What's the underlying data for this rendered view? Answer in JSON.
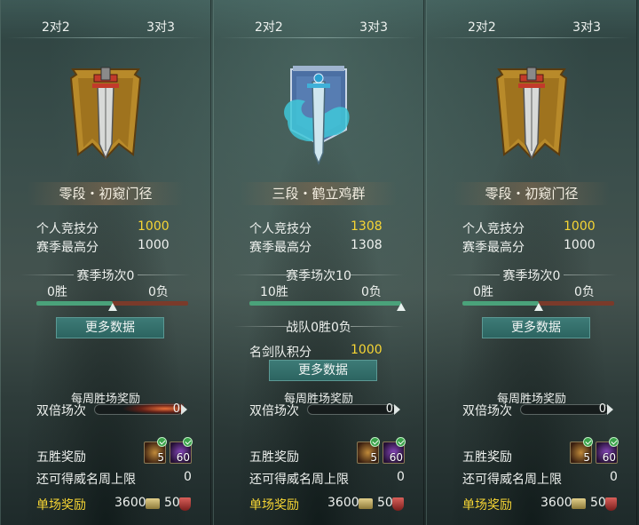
{
  "panels": [
    {
      "tabs": [
        "2对2",
        "3对3"
      ],
      "emblem": "banner-sword-bronze",
      "rank_title": "零段・初窥门径",
      "personal_score_label": "个人竞技分",
      "personal_score": "1000",
      "season_high_label": "赛季最高分",
      "season_high": "1000",
      "season_matches_title": "赛季场次0",
      "wins": "0胜",
      "losses": "0负",
      "win_ratio": 0.5,
      "more_button": "更多数据",
      "weekly_title": "每周胜场奖励",
      "double_label": "双倍场次",
      "double_value": "0",
      "five_win_label": "五胜奖励",
      "reward_items": [
        {
          "icon": "tactics-scroll-icon",
          "count": "5"
        },
        {
          "icon": "purple-gem-icon",
          "count": "60"
        }
      ],
      "remaining_label": "还可得威名周上限",
      "remaining_value": "0",
      "single_reward_label": "单场奖励",
      "coin_value": "3600",
      "shield_value": "50"
    },
    {
      "tabs": [
        "2对2",
        "3对3"
      ],
      "emblem": "banner-sword-crane",
      "rank_title": "三段・鹤立鸡群",
      "personal_score_label": "个人竞技分",
      "personal_score": "1308",
      "season_high_label": "赛季最高分",
      "season_high": "1308",
      "season_matches_title": "赛季场次10",
      "wins": "10胜",
      "losses": "0负",
      "win_ratio": 1.0,
      "team_title": "战队0胜0负",
      "team_score_label": "名剑队积分",
      "team_score": "1000",
      "more_button": "更多数据",
      "weekly_title": "每周胜场奖励",
      "double_label": "双倍场次",
      "double_value": "0",
      "five_win_label": "五胜奖励",
      "reward_items": [
        {
          "icon": "tactics-scroll-icon",
          "count": "5"
        },
        {
          "icon": "purple-gem-icon",
          "count": "60"
        }
      ],
      "remaining_label": "还可得威名周上限",
      "remaining_value": "0",
      "single_reward_label": "单场奖励",
      "coin_value": "3600",
      "shield_value": "50"
    },
    {
      "tabs": [
        "2对2",
        "3对3"
      ],
      "emblem": "banner-sword-bronze",
      "rank_title": "零段・初窥门径",
      "personal_score_label": "个人竞技分",
      "personal_score": "1000",
      "season_high_label": "赛季最高分",
      "season_high": "1000",
      "season_matches_title": "赛季场次0",
      "wins": "0胜",
      "losses": "0负",
      "win_ratio": 0.5,
      "more_button": "更多数据",
      "weekly_title": "每周胜场奖励",
      "double_label": "双倍场次",
      "double_value": "0",
      "five_win_label": "五胜奖励",
      "reward_items": [
        {
          "icon": "tactics-scroll-icon",
          "count": "5"
        },
        {
          "icon": "purple-gem-icon",
          "count": "60"
        }
      ],
      "remaining_label": "还可得威名周上限",
      "remaining_value": "0",
      "single_reward_label": "单场奖励",
      "coin_value": "3600",
      "shield_value": "50"
    }
  ],
  "colors": {
    "highlight_gold": "#f6d534",
    "win_bar": "#4aa27a",
    "loss_bar": "#7a3a2a",
    "button_teal": "#3d7b77"
  }
}
